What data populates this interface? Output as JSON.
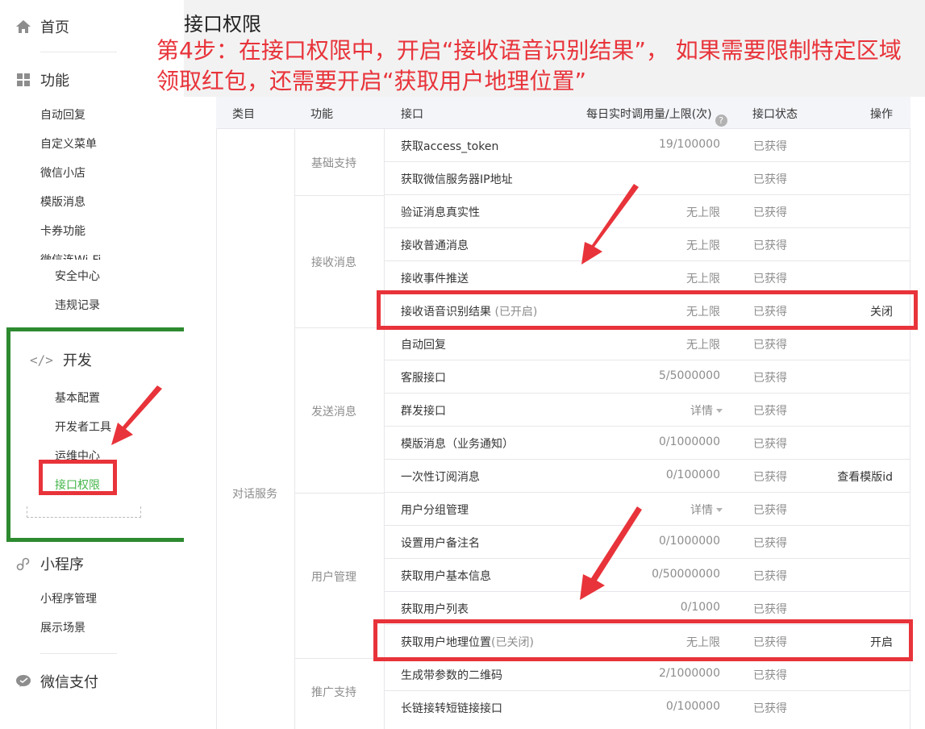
{
  "page_title": "接口权限",
  "annotation": "第4步：在接口权限中，开启“接收语音识别结果”， 如果需要限制特定区域领取红包，还需要开启“获取用户地理位置”",
  "colors": {
    "annotation": "#e8333a",
    "green_box": "#2d8a2f",
    "active": "#44b549"
  },
  "sidebar": {
    "home": {
      "label": "首页",
      "icon": "home-icon"
    },
    "features": {
      "label": "功能",
      "icon": "grid-icon",
      "items": [
        "自动回复",
        "自定义菜单",
        "微信小店",
        "模版消息",
        "卡券功能",
        "微信连Wi-Fi"
      ]
    },
    "mid_items": [
      "安全中心",
      "违规记录"
    ],
    "dev": {
      "label": "开发",
      "icon": "code-icon",
      "items": [
        "基本配置",
        "开发者工具",
        "运维中心",
        "接口权限"
      ]
    },
    "miniprogram": {
      "label": "小程序",
      "icon": "link-icon",
      "items": [
        "小程序管理",
        "展示场景"
      ]
    },
    "pay": {
      "label": "微信支付",
      "icon": "pay-icon"
    }
  },
  "table": {
    "headers": {
      "category": "类目",
      "function": "功能",
      "api": "接口",
      "quota": "每日实时调用量/上限(次)",
      "status": "接口状态",
      "op": "操作"
    },
    "category": "对话服务",
    "groups": [
      {
        "name": "基础支持"
      },
      {
        "name": "接收消息"
      },
      {
        "name": "发送消息"
      },
      {
        "name": "用户管理"
      },
      {
        "name": "推广支持"
      }
    ],
    "rows": [
      {
        "api": "获取access_token",
        "sub": "",
        "quota": "19/100000",
        "status": "已获得",
        "op": ""
      },
      {
        "api": "获取微信服务器IP地址",
        "sub": "",
        "quota": "",
        "status": "已获得",
        "op": ""
      },
      {
        "api": "验证消息真实性",
        "sub": "",
        "quota": "无上限",
        "status": "已获得",
        "op": ""
      },
      {
        "api": "接收普通消息",
        "sub": "",
        "quota": "无上限",
        "status": "已获得",
        "op": ""
      },
      {
        "api": "接收事件推送",
        "sub": "",
        "quota": "无上限",
        "status": "已获得",
        "op": ""
      },
      {
        "api": "接收语音识别结果",
        "sub": " (已开启)",
        "quota": "无上限",
        "status": "已获得",
        "op": "关闭"
      },
      {
        "api": "自动回复",
        "sub": "",
        "quota": "无上限",
        "status": "已获得",
        "op": ""
      },
      {
        "api": "客服接口",
        "sub": "",
        "quota": "5/5000000",
        "status": "已获得",
        "op": ""
      },
      {
        "api": "群发接口",
        "sub": "",
        "quota": "详情",
        "status": "已获得",
        "op": ""
      },
      {
        "api": "模版消息（业务通知）",
        "sub": "",
        "quota": "0/1000000",
        "status": "已获得",
        "op": ""
      },
      {
        "api": "一次性订阅消息",
        "sub": "",
        "quota": "0/100000",
        "status": "已获得",
        "op": "查看模版id"
      },
      {
        "api": "用户分组管理",
        "sub": "",
        "quota": "详情",
        "status": "已获得",
        "op": ""
      },
      {
        "api": "设置用户备注名",
        "sub": "",
        "quota": "0/1000000",
        "status": "已获得",
        "op": ""
      },
      {
        "api": "获取用户基本信息",
        "sub": "",
        "quota": "0/50000000",
        "status": "已获得",
        "op": ""
      },
      {
        "api": "获取用户列表",
        "sub": "",
        "quota": "0/1000",
        "status": "已获得",
        "op": ""
      },
      {
        "api": "获取用户地理位置",
        "sub": "(已关闭)",
        "quota": "无上限",
        "status": "已获得",
        "op": "开启"
      },
      {
        "api": "生成带参数的二维码",
        "sub": "",
        "quota": "2/1000000",
        "status": "已获得",
        "op": ""
      },
      {
        "api": "长链接转短链接接口",
        "sub": "",
        "quota": "0/100000",
        "status": "已获得",
        "op": ""
      }
    ]
  }
}
